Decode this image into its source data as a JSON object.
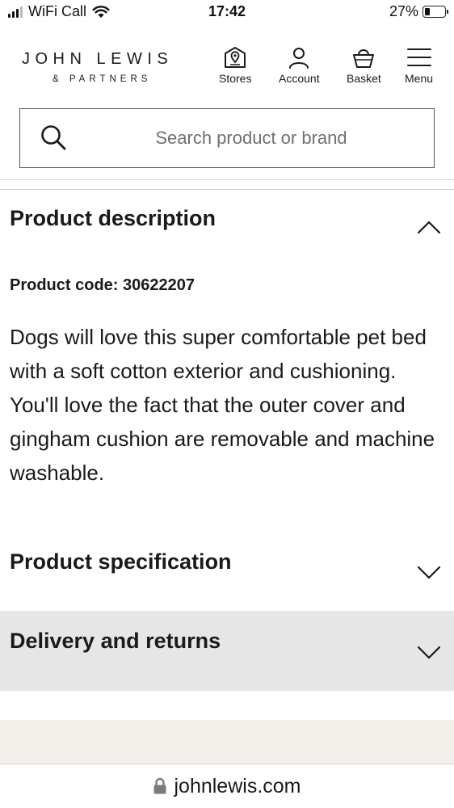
{
  "status_bar": {
    "carrier": "WiFi Call",
    "time": "17:42",
    "battery_percent_label": "27%",
    "battery_level": 0.27
  },
  "header": {
    "logo_main": "JOHN LEWIS",
    "logo_sub": "& PARTNERS",
    "nav": [
      {
        "label": "Stores",
        "icon": "store-locator-icon"
      },
      {
        "label": "Account",
        "icon": "account-icon"
      },
      {
        "label": "Basket",
        "icon": "basket-icon"
      },
      {
        "label": "Menu",
        "icon": "hamburger-menu-icon"
      }
    ]
  },
  "search": {
    "placeholder": "Search product or brand",
    "value": ""
  },
  "product_description": {
    "heading": "Product description",
    "expanded": true,
    "code_label": "Product code: 30622207",
    "text": "Dogs will love this super comfortable pet bed with a soft cotton exterior and cushioning. You'll love the fact that the outer cover and gingham cushion are removable and machine washable."
  },
  "product_specification": {
    "heading": "Product specification",
    "expanded": false
  },
  "delivery_returns": {
    "heading": "Delivery and returns",
    "expanded": false
  },
  "browser": {
    "url": "johnlewis.com"
  },
  "colors": {
    "text": "#1a1a1a",
    "delivery_bg": "#e6e6e6",
    "beige": "#f3f0ec"
  }
}
